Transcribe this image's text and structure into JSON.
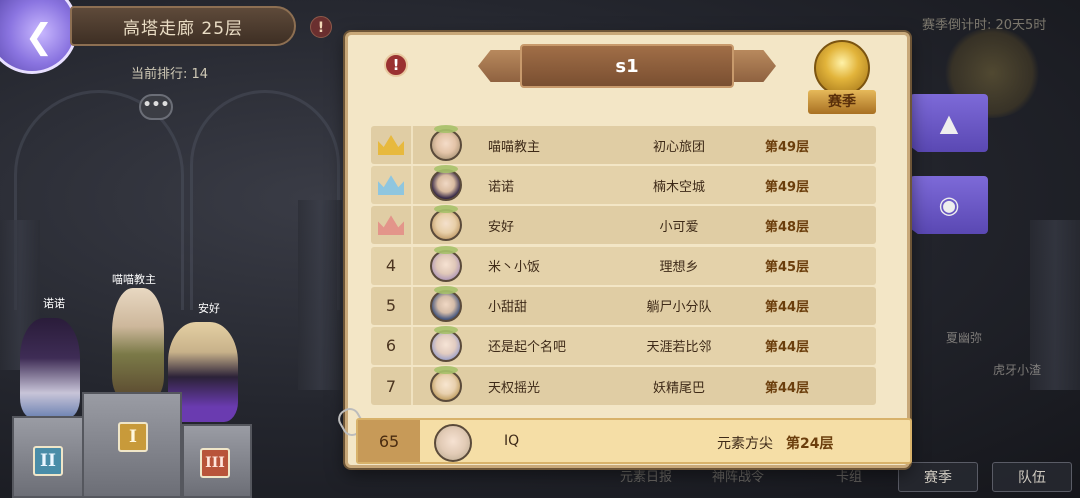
{
  "header": {
    "tower_title": "高塔走廊 25层",
    "current_rank_text": "当前排行: 14",
    "countdown_text": "赛季倒计时: 20天5时"
  },
  "characters": [
    {
      "name": "诺诺"
    },
    {
      "name": "喵喵教主"
    },
    {
      "name": "安好"
    }
  ],
  "pedestals": [
    {
      "label": "II",
      "color": "#4a8da8"
    },
    {
      "label": "I",
      "color": "#c89a3a"
    },
    {
      "label": "III",
      "color": "#b8543a"
    }
  ],
  "faded_right_labels": [
    "夏幽弥",
    "虎牙小渣"
  ],
  "bottom_tabs": [
    "元素日报",
    "神阵战令",
    "卡组"
  ],
  "bottom_right_tabs": [
    "赛季",
    "队伍"
  ],
  "panel": {
    "season_label": "s1",
    "season_badge_text": "赛季",
    "rankings": [
      {
        "rank": "1",
        "crown": "gold",
        "crown_color": "#e7b93e",
        "name": "喵喵教主",
        "guild": "初心旅团",
        "floor": "第49层"
      },
      {
        "rank": "2",
        "crown": "silver",
        "crown_color": "#8fc6df",
        "name": "诺诺",
        "guild": "楠木空城",
        "floor": "第49层"
      },
      {
        "rank": "3",
        "crown": "bronze",
        "crown_color": "#e3958a",
        "name": "安好",
        "guild": "小可爱",
        "floor": "第48层"
      },
      {
        "rank": "4",
        "name": "米丶小饭",
        "guild": "理想乡",
        "floor": "第45层"
      },
      {
        "rank": "5",
        "name": "小甜甜",
        "guild": "躺尸小分队",
        "floor": "第44层"
      },
      {
        "rank": "6",
        "name": "还是起个名吧",
        "guild": "天涯若比邻",
        "floor": "第44层"
      },
      {
        "rank": "7",
        "name": "天权摇光",
        "guild": "妖精尾巴",
        "floor": "第44层"
      }
    ],
    "self_row": {
      "rank": "65",
      "name": "IQ",
      "guild": "元素方尖",
      "floor": "第24层"
    }
  }
}
